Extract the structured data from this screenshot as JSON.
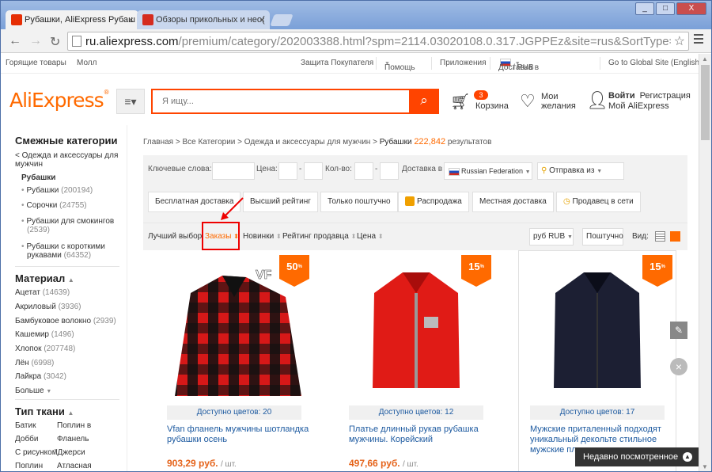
{
  "browser": {
    "tabs": [
      {
        "title": "Рубашки, AliExpress Рубаш"
      },
      {
        "title": "Обзоры прикольных и нео("
      }
    ],
    "window_buttons": {
      "minimize": "_",
      "maximize": "□",
      "close": "X"
    },
    "url_host": "ru.aliexpress.com",
    "url_path": "/premium/category/202003388.html?spm=2114.03020108.0.317.JGPPEz&site=rus&SortType=total_"
  },
  "topstrip": {
    "left": [
      "Горящие товары",
      "Молл"
    ],
    "protection": "Защита Покупателя",
    "help": "Помощь",
    "apps": "Приложения",
    "delivery": "Доставка в",
    "currency": "/ RUB",
    "global": "Go to Global Site (English)"
  },
  "header": {
    "logo": "AliExpress",
    "search_placeholder": "Я ищу...",
    "cart_count": "3",
    "cart_label": "Корзина",
    "wish_label_1": "Мои",
    "wish_label_2": "желания",
    "login": "Войти",
    "register": "Регистрация",
    "my_ali": "Мой AliExpress"
  },
  "sidebar": {
    "related_title": "Смежные категории",
    "parent_link": "< Одежда и аксессуары для",
    "parent_link_2": "мужчин",
    "current": "Рубашки",
    "items": [
      {
        "label": "Рубашки",
        "count": "(200194)"
      },
      {
        "label": "Сорочки",
        "count": "(24755)"
      },
      {
        "label": "Рубашки для смокингов",
        "count": "(2539)"
      },
      {
        "label": "Рубашки с короткими",
        "label2": "рукавами",
        "count": "(64352)"
      }
    ],
    "material_title": "Материал",
    "materials": [
      {
        "label": "Ацетат",
        "count": "(14639)"
      },
      {
        "label": "Акриловый",
        "count": "(3936)"
      },
      {
        "label": "Бамбуковое волокно",
        "count": "(2939)"
      },
      {
        "label": "Кашемир",
        "count": "(1496)"
      },
      {
        "label": "Хлопок",
        "count": "(207748)"
      },
      {
        "label": "Лён",
        "count": "(6998)"
      },
      {
        "label": "Лайкра",
        "count": "(3042)"
      }
    ],
    "more": "Больше",
    "fabric_title": "Тип ткани",
    "fabrics": [
      "Батик",
      "Поплин в",
      "Добби",
      "Фланель",
      "С рисунком",
      "\"Джерси",
      "Поплин",
      "Атласная"
    ]
  },
  "breadcrumb": {
    "path": "Главная > Все Категории > Одежда и аксессуары для мужчин >",
    "current": "Рубашки",
    "count": "222,842",
    "suffix": "результатов"
  },
  "filters": {
    "keywords": "Ключевые слова:",
    "price": "Цена:",
    "qty": "Кол-во:",
    "ship_to": "Доставка в",
    "country": "Russian Federation",
    "ship_from": "Отправка из",
    "buttons": [
      "Бесплатная доставка",
      "Высший рейтинг",
      "Только поштучно",
      "Распродажа",
      "Местная доставка",
      "Продавец в сети"
    ]
  },
  "sort": {
    "best": "Лучший выбор",
    "orders": "Заказы",
    "new": "Новинки",
    "seller_rating": "Рейтинг продавца",
    "price": "Цена",
    "currency": "руб RUB",
    "unit": "Поштучно",
    "view": "Вид:"
  },
  "products": [
    {
      "discount": "50",
      "off": "OFF",
      "colors": "Доступно цветов: 20",
      "title": "Vfan фланель мужчины шотландка рубашки осень",
      "price": "903,29 руб.",
      "unit": "/ шт."
    },
    {
      "discount": "15",
      "off": "OFF",
      "colors": "Доступно цветов: 12",
      "title": "Платье длинный рукав рубашка мужчины. Корейский",
      "price": "497,66 руб.",
      "unit": "/ шт."
    },
    {
      "discount": "15",
      "off": "OFF",
      "colors": "Доступно цветов: 17",
      "title": "Мужские приталенный подходят уникальный декольте стильное мужские пл",
      "price": "",
      "unit": ""
    }
  ],
  "recent": "Недавно посмотренное",
  "colors": {
    "brand": "#ff4400",
    "logo": "#ff6a00",
    "link": "#1d5aa0",
    "price": "#e5631a"
  }
}
